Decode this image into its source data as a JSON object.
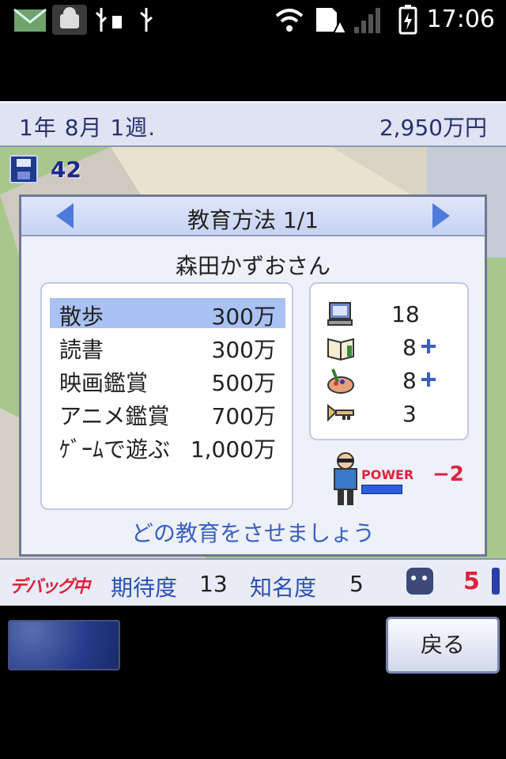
{
  "status_bar": {
    "time": "17:06",
    "icons": [
      "mail-icon",
      "android-debug-icon",
      "usb-icon",
      "usb-icon",
      "wifi-icon",
      "sd-card-warning-icon",
      "signal-icon",
      "battery-charging-icon"
    ]
  },
  "top_bar": {
    "date": "1年 8月 1週.",
    "money": "2,950万円"
  },
  "save_slot": {
    "count": "42"
  },
  "dialog": {
    "title": "教育方法 1/1",
    "person_name": "森田かずおさん",
    "menu": [
      {
        "label": "散歩",
        "cost": "300万",
        "selected": true
      },
      {
        "label": "読書",
        "cost": "300万",
        "selected": false
      },
      {
        "label": "映画鑑賞",
        "cost": "500万",
        "selected": false
      },
      {
        "label": "アニメ鑑賞",
        "cost": "700万",
        "selected": false
      },
      {
        "label": "ｹﾞｰﾑで遊ぶ",
        "cost": "1,000万",
        "selected": false
      }
    ],
    "stats": [
      {
        "icon": "computer-icon",
        "value": "18",
        "plus": false
      },
      {
        "icon": "book-icon",
        "value": "8",
        "plus": true
      },
      {
        "icon": "art-palette-icon",
        "value": "8",
        "plus": true
      },
      {
        "icon": "trumpet-icon",
        "value": "3",
        "plus": false
      }
    ],
    "power_label": "POWER",
    "power_value": "−2",
    "prompt": "どの教育をさせましょう"
  },
  "bottom_bar": {
    "debug_label": "デバッグ中",
    "expectation_label": "期待度",
    "expectation_value": "13",
    "fame_label": "知名度",
    "fame_value": "5",
    "monster_count": "5"
  },
  "buttons": {
    "back_label": "戻る"
  },
  "colors": {
    "accent_blue": "#3a5fc2",
    "selection": "#a9c1f3",
    "warning_red": "#e0213a"
  }
}
